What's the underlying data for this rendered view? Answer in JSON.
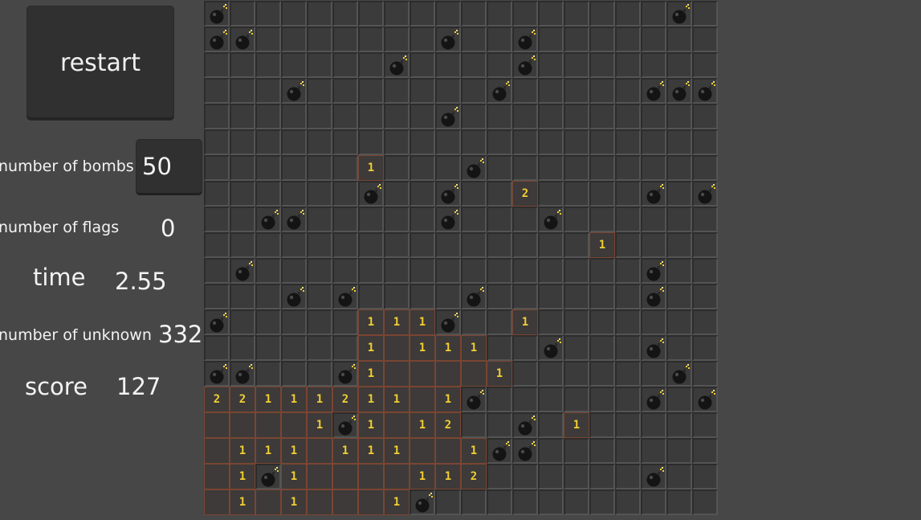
{
  "panel": {
    "restart_label": "restart",
    "bombs_label": "number of bombs",
    "bombs_value": "50",
    "flags_label": "number of flags",
    "flags_value": "0",
    "time_label": "time",
    "time_value": "2.55",
    "unknown_label": "number of unknown",
    "unknown_value": "332",
    "score_label": "score",
    "score_value": "127"
  },
  "board": {
    "cols": 20,
    "rows": 20,
    "legend": {
      ".": "hidden",
      "o": "open-empty",
      "*": "bomb",
      "1": "number-1",
      "2": "number-2"
    },
    "grid": [
      "*.................*.**.",
      "**.......*..*.........",
      ".......*....*.........",
      "...*.......*.....***..",
      ".........*............",
      "......................",
      "......1...*.........*.",
      "......*..*..2....*.*..",
      "..**.....*...*........",
      "...............1......",
      ".*...............*....",
      "...*.*....*......*....",
      "*.....111*..1.........",
      "......1o111..*...*....",
      "**...*1oooo1......*...",
      "22111211o1*......*.*..",
      "oooo1*1o12..*.1.......",
      "o111o111oo1**.........",
      "o1*1oooo112......*....",
      "o1o1ooo1*.............."
    ],
    "colors": {
      "number": "#f1cf32",
      "open_border": "#7a4532",
      "hidden_fill": "#3b3b3b"
    }
  }
}
